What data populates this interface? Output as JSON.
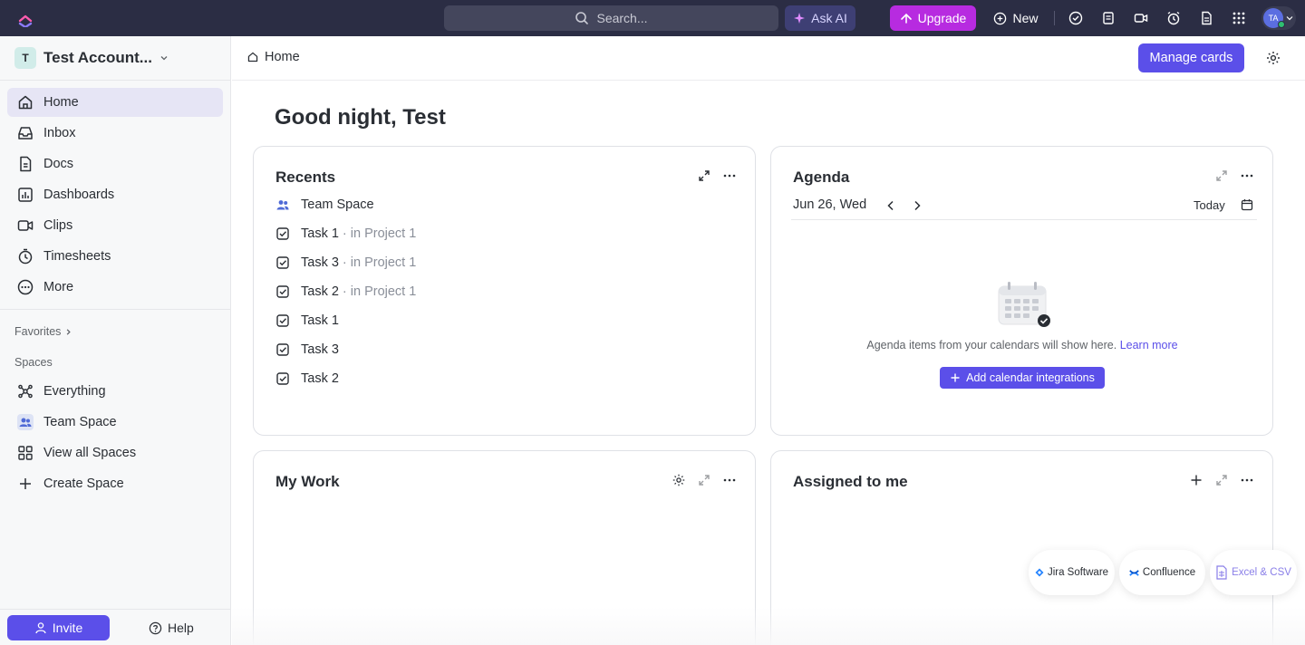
{
  "topbar": {
    "search_placeholder": "Search...",
    "ask_ai_label": "Ask AI",
    "upgrade_label": "Upgrade",
    "new_label": "New",
    "avatar_initials": "TA"
  },
  "sidebar": {
    "workspace_initial": "T",
    "workspace_name": "Test Account...",
    "nav": [
      {
        "label": "Home",
        "icon": "home-icon"
      },
      {
        "label": "Inbox",
        "icon": "inbox-icon"
      },
      {
        "label": "Docs",
        "icon": "docs-icon"
      },
      {
        "label": "Dashboards",
        "icon": "dashboards-icon"
      },
      {
        "label": "Clips",
        "icon": "clips-icon"
      },
      {
        "label": "Timesheets",
        "icon": "timesheets-icon"
      },
      {
        "label": "More",
        "icon": "more-icon"
      }
    ],
    "favorites_label": "Favorites",
    "spaces_label": "Spaces",
    "spaces": [
      {
        "label": "Everything",
        "icon": "everything-icon"
      },
      {
        "label": "Team Space",
        "icon": "team-icon"
      },
      {
        "label": "View all Spaces",
        "icon": "grid-icon"
      },
      {
        "label": "Create Space",
        "icon": "plus-icon"
      }
    ],
    "invite_label": "Invite",
    "help_label": "Help"
  },
  "main": {
    "breadcrumb": "Home",
    "manage_cards_label": "Manage cards",
    "greeting": "Good night, Test"
  },
  "recents": {
    "title": "Recents",
    "items": [
      {
        "name": "Team Space",
        "location": ""
      },
      {
        "name": "Task 1",
        "location": "in Project 1"
      },
      {
        "name": "Task 3",
        "location": "in Project 1"
      },
      {
        "name": "Task 2",
        "location": "in Project 1"
      },
      {
        "name": "Task 1",
        "location": ""
      },
      {
        "name": "Task 3",
        "location": ""
      },
      {
        "name": "Task 2",
        "location": ""
      }
    ]
  },
  "agenda": {
    "title": "Agenda",
    "date": "Jun 26, Wed",
    "today_label": "Today",
    "empty_message": "Agenda items from your calendars will show here.",
    "learn_more": "Learn more",
    "add_integration_label": "Add calendar integrations"
  },
  "my_work": {
    "title": "My Work"
  },
  "assigned": {
    "title": "Assigned to me"
  },
  "integrations": [
    {
      "label": "Jira Software"
    },
    {
      "label": "Confluence"
    },
    {
      "label": "Excel & CSV"
    }
  ],
  "colors": {
    "accent": "#5b4fe9",
    "topbar": "#2b2d44",
    "upgrade": "#b72be0"
  }
}
